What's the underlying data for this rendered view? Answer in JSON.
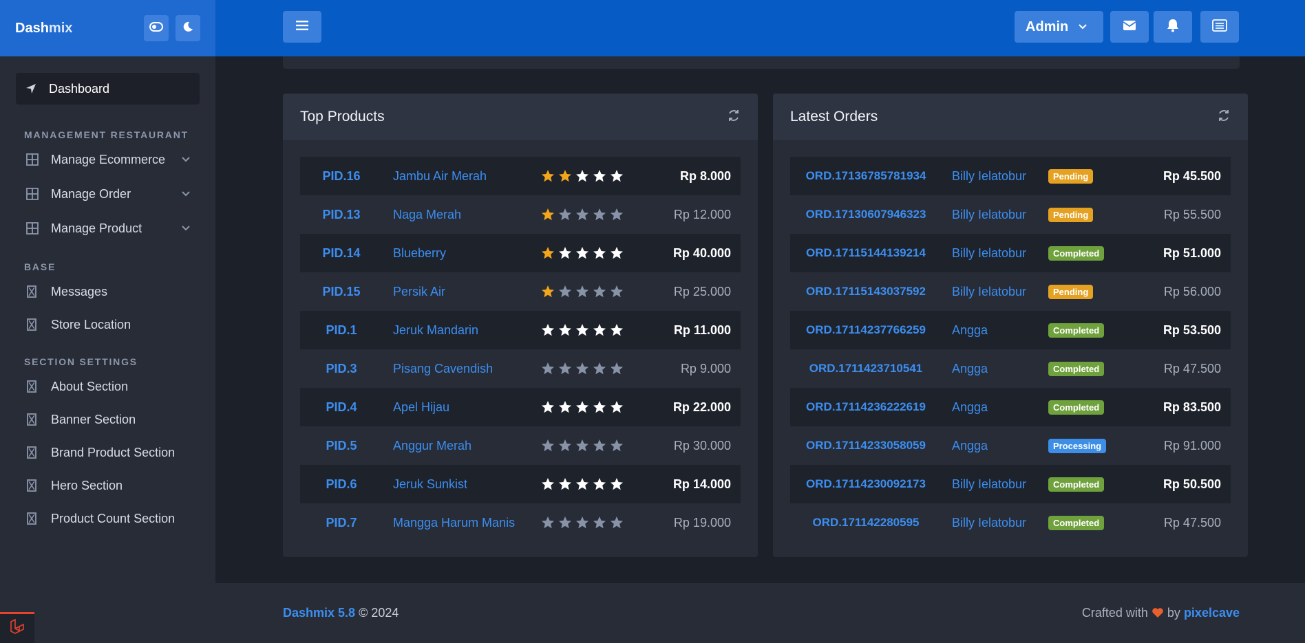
{
  "sidebar": {
    "brand_main": "Dash",
    "brand_rest": "mix",
    "active_item": "Dashboard",
    "sections": [
      {
        "heading": "MANAGEMENT RESTAURANT",
        "items": [
          "Manage Ecommerce",
          "Manage Order",
          "Manage Product"
        ]
      },
      {
        "heading": "BASE",
        "items": [
          "Messages",
          "Store Location"
        ]
      },
      {
        "heading": "SECTION SETTINGS",
        "items": [
          "About Section",
          "Banner Section",
          "Brand Product Section",
          "Hero Section",
          "Product Count Section"
        ]
      }
    ]
  },
  "topbar": {
    "user_label": "Admin"
  },
  "top_products": {
    "title": "Top Products",
    "rows": [
      {
        "id": "PID.16",
        "name": "Jambu Air Merah",
        "rating": 2,
        "price": "Rp 8.000"
      },
      {
        "id": "PID.13",
        "name": "Naga Merah",
        "rating": 1,
        "price": "Rp 12.000"
      },
      {
        "id": "PID.14",
        "name": "Blueberry",
        "rating": 1,
        "price": "Rp 40.000"
      },
      {
        "id": "PID.15",
        "name": "Persik Air",
        "rating": 1,
        "price": "Rp 25.000"
      },
      {
        "id": "PID.1",
        "name": "Jeruk Mandarin",
        "rating": 0,
        "price": "Rp 11.000"
      },
      {
        "id": "PID.3",
        "name": "Pisang Cavendish",
        "rating": 0,
        "price": "Rp 9.000"
      },
      {
        "id": "PID.4",
        "name": "Apel Hijau",
        "rating": 0,
        "price": "Rp 22.000"
      },
      {
        "id": "PID.5",
        "name": "Anggur Merah",
        "rating": 0,
        "price": "Rp 30.000"
      },
      {
        "id": "PID.6",
        "name": "Jeruk Sunkist",
        "rating": 0,
        "price": "Rp 14.000"
      },
      {
        "id": "PID.7",
        "name": "Mangga Harum Manis",
        "rating": 0,
        "price": "Rp 19.000"
      }
    ]
  },
  "latest_orders": {
    "title": "Latest Orders",
    "rows": [
      {
        "id": "ORD.17136785781934",
        "customer": "Billy Ielatobur",
        "status": "Pending",
        "total": "Rp 45.500"
      },
      {
        "id": "ORD.17130607946323",
        "customer": "Billy Ielatobur",
        "status": "Pending",
        "total": "Rp 55.500"
      },
      {
        "id": "ORD.17115144139214",
        "customer": "Billy Ielatobur",
        "status": "Completed",
        "total": "Rp 51.000"
      },
      {
        "id": "ORD.17115143037592",
        "customer": "Billy Ielatobur",
        "status": "Pending",
        "total": "Rp 56.000"
      },
      {
        "id": "ORD.17114237766259",
        "customer": "Angga",
        "status": "Completed",
        "total": "Rp 53.500"
      },
      {
        "id": "ORD.1711423710541",
        "customer": "Angga",
        "status": "Completed",
        "total": "Rp 47.500"
      },
      {
        "id": "ORD.17114236222619",
        "customer": "Angga",
        "status": "Completed",
        "total": "Rp 83.500"
      },
      {
        "id": "ORD.17114233058059",
        "customer": "Angga",
        "status": "Processing",
        "total": "Rp 91.000"
      },
      {
        "id": "ORD.17114230092173",
        "customer": "Billy Ielatobur",
        "status": "Completed",
        "total": "Rp 50.500"
      },
      {
        "id": "ORD.171142280595",
        "customer": "Billy Ielatobur",
        "status": "Completed",
        "total": "Rp 47.500"
      }
    ]
  },
  "footer": {
    "product": "Dashmix 5.8",
    "copyright": "© 2024",
    "crafted": "Crafted with",
    "by": "by",
    "author": "pixelcave"
  },
  "colors": {
    "accent": "#065bc4",
    "link": "#3c8ef0",
    "star_on": "#f3a51b",
    "star_off": "#8893a8",
    "pending": "#e5a222",
    "completed": "#6fa13d",
    "processing": "#3c8ee6"
  },
  "icons": [
    "theme-toggle-icon",
    "moon-icon",
    "menu-icon",
    "chevron-down-icon",
    "mail-icon",
    "bell-icon",
    "list-icon",
    "refresh-icon",
    "location-arrow-icon",
    "grid-icon",
    "hourglass-icon",
    "heart-icon",
    "laravel-icon"
  ]
}
